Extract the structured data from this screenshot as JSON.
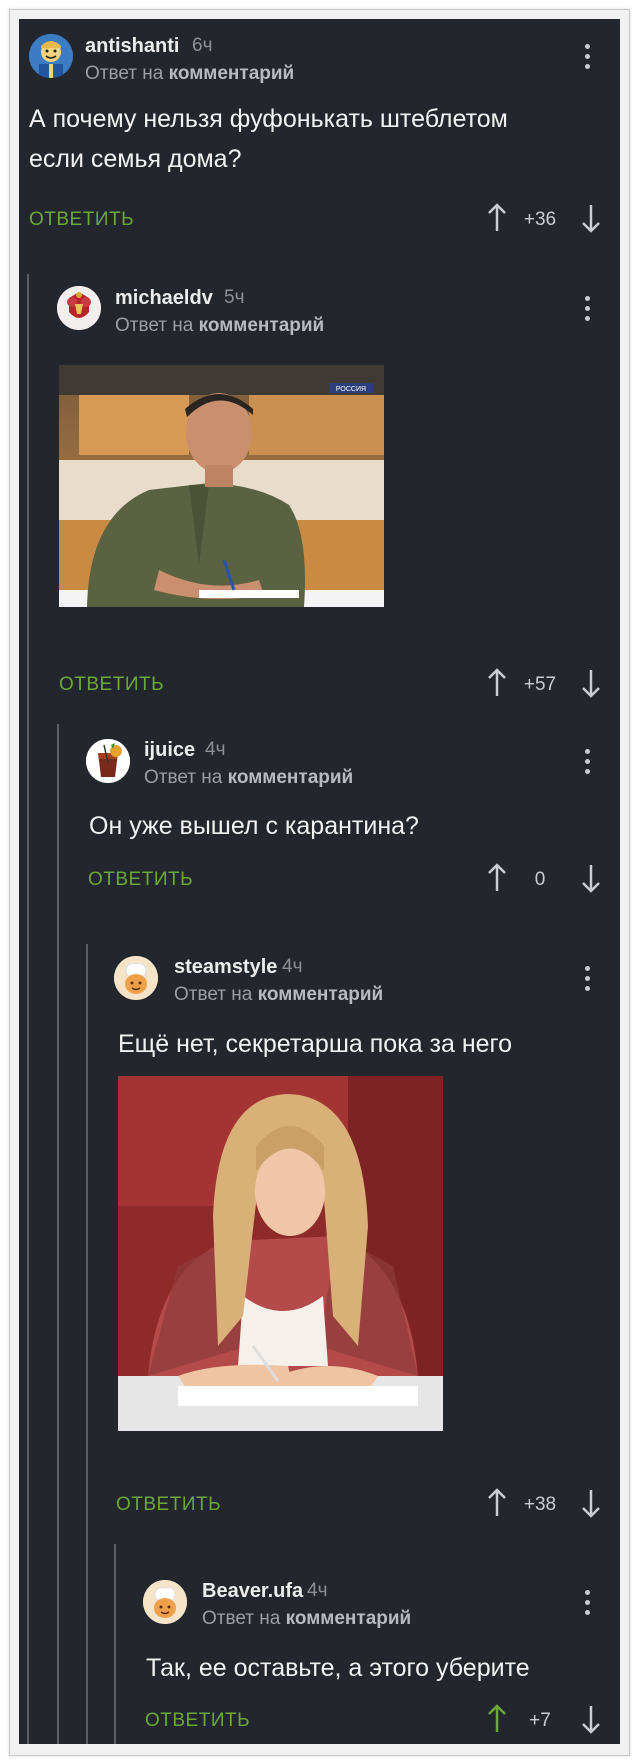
{
  "reply_to_prefix": "Ответ на",
  "reply_to_target": "комментарий",
  "reply_label": "ОТВЕТИТЬ",
  "colors": {
    "background": "#23262c",
    "reply_button": "#6aa83a",
    "upvote_active": "#6aa83a",
    "text": "#f2f2f2",
    "thread_line": "#5b5f66"
  },
  "comments": [
    {
      "username": "antishanti",
      "time": "6ч",
      "text": "А почему нельзя фуфонькать штеблетом если семья дома?",
      "score": "+36",
      "avatar_icon": "vault-boy-avatar-icon"
    },
    {
      "username": "michaeldv",
      "time": "5ч",
      "text": "",
      "score": "+57",
      "avatar_icon": "crest-avatar-icon",
      "image": {
        "description": "man-writing-photo",
        "badge": "РОССИЯ"
      }
    },
    {
      "username": "ijuice",
      "time": "4ч",
      "text": "Он уже вышел с карантина?",
      "score": "0",
      "avatar_icon": "juice-glass-avatar-icon"
    },
    {
      "username": "steamstyle",
      "time": "4ч",
      "text": "Ещё нет, секретарша пока за него",
      "score": "+38",
      "avatar_icon": "chef-avatar-icon",
      "image": {
        "description": "woman-writing-photo"
      }
    },
    {
      "username": "Beaver.ufa",
      "time": "4ч",
      "text": "Так, ее оставьте, а этого уберите",
      "score": "+7",
      "avatar_icon": "chef-avatar-icon",
      "upvoted": true
    }
  ]
}
